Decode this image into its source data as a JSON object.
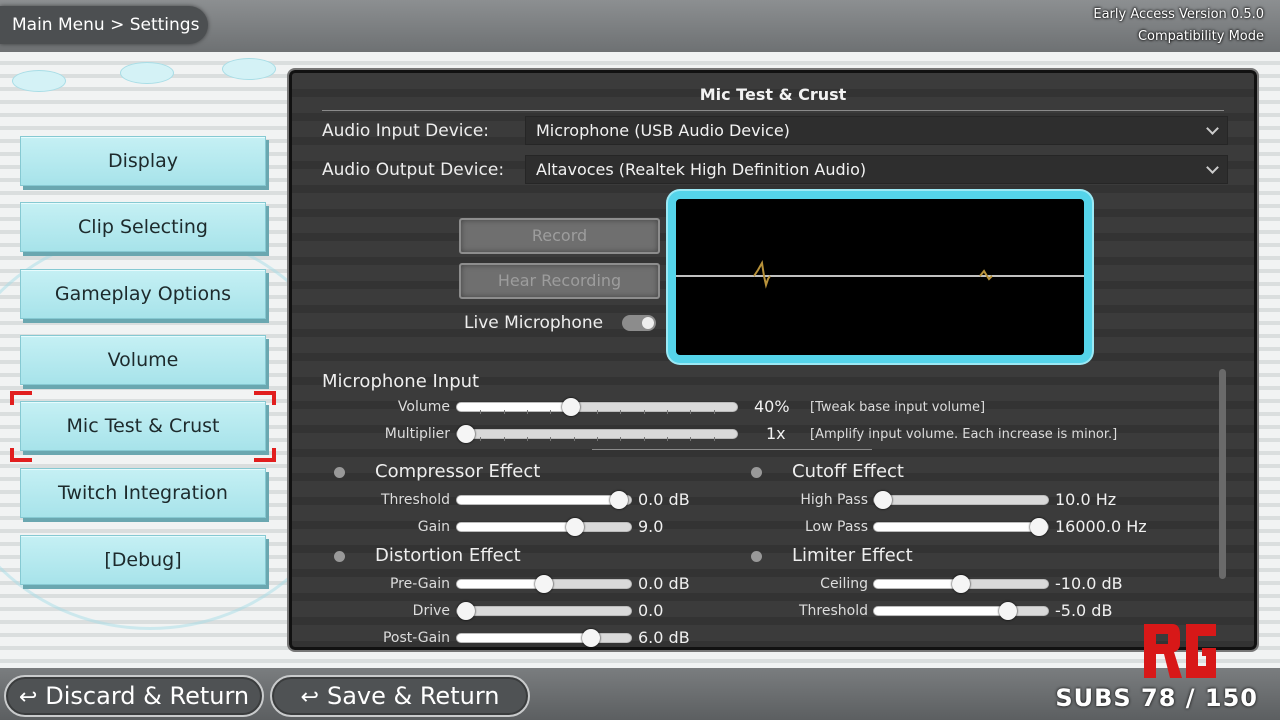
{
  "breadcrumb": "Main Menu > Settings",
  "version": {
    "line1": "Early Access Version 0.5.0",
    "line2": "Compatibility Mode"
  },
  "sidebar": {
    "items": [
      {
        "label": "Display"
      },
      {
        "label": "Clip Selecting"
      },
      {
        "label": "Gameplay Options"
      },
      {
        "label": "Volume"
      },
      {
        "label": "Mic Test & Crust",
        "selected": true
      },
      {
        "label": "Twitch Integration"
      },
      {
        "label": "[Debug]"
      }
    ]
  },
  "panel": {
    "title": "Mic Test & Crust",
    "input_device_label": "Audio Input Device:",
    "input_device_value": "Microphone (USB Audio Device)",
    "output_device_label": "Audio Output Device:",
    "output_device_value": "Altavoces (Realtek High Definition Audio)",
    "record_label": "Record",
    "hear_label": "Hear Recording",
    "live_mic_label": "Live Microphone",
    "live_mic_on": true
  },
  "mic_input": {
    "heading": "Microphone Input",
    "volume": {
      "label": "Volume",
      "value": "40%",
      "fraction": 0.4,
      "hint": "[Tweak base input volume]"
    },
    "multiplier": {
      "label": "Multiplier",
      "value": "1x",
      "fraction": 0.0,
      "hint": "[Amplify input volume. Each increase is minor.]"
    }
  },
  "effects": {
    "compressor": {
      "heading": "Compressor Effect",
      "threshold": {
        "label": "Threshold",
        "value": "0.0 dB",
        "fraction": 0.98
      },
      "gain": {
        "label": "Gain",
        "value": "9.0",
        "fraction": 0.7
      }
    },
    "distortion": {
      "heading": "Distortion Effect",
      "pregain": {
        "label": "Pre-Gain",
        "value": "0.0 dB",
        "fraction": 0.5
      },
      "drive": {
        "label": "Drive",
        "value": "0.0",
        "fraction": 0.0
      },
      "postgain": {
        "label": "Post-Gain",
        "value": "6.0 dB",
        "fraction": 0.8
      }
    },
    "cutoff": {
      "heading": "Cutoff Effect",
      "highpass": {
        "label": "High Pass",
        "value": "10.0 Hz",
        "fraction": 0.0
      },
      "lowpass": {
        "label": "Low Pass",
        "value": "16000.0 Hz",
        "fraction": 1.0
      }
    },
    "limiter": {
      "heading": "Limiter Effect",
      "ceiling": {
        "label": "Ceiling",
        "value": "-10.0 dB",
        "fraction": 0.5
      },
      "threshold": {
        "label": "Threshold",
        "value": "-5.0 dB",
        "fraction": 0.8
      }
    }
  },
  "footer": {
    "discard_label": "Discard & Return",
    "save_label": "Save & Return",
    "subs": "SUBS 78 / 150"
  },
  "colors": {
    "accent_cyan": "#55d4ea",
    "selection_red": "#e11e1e",
    "nav_button": "#a7e3ea"
  }
}
